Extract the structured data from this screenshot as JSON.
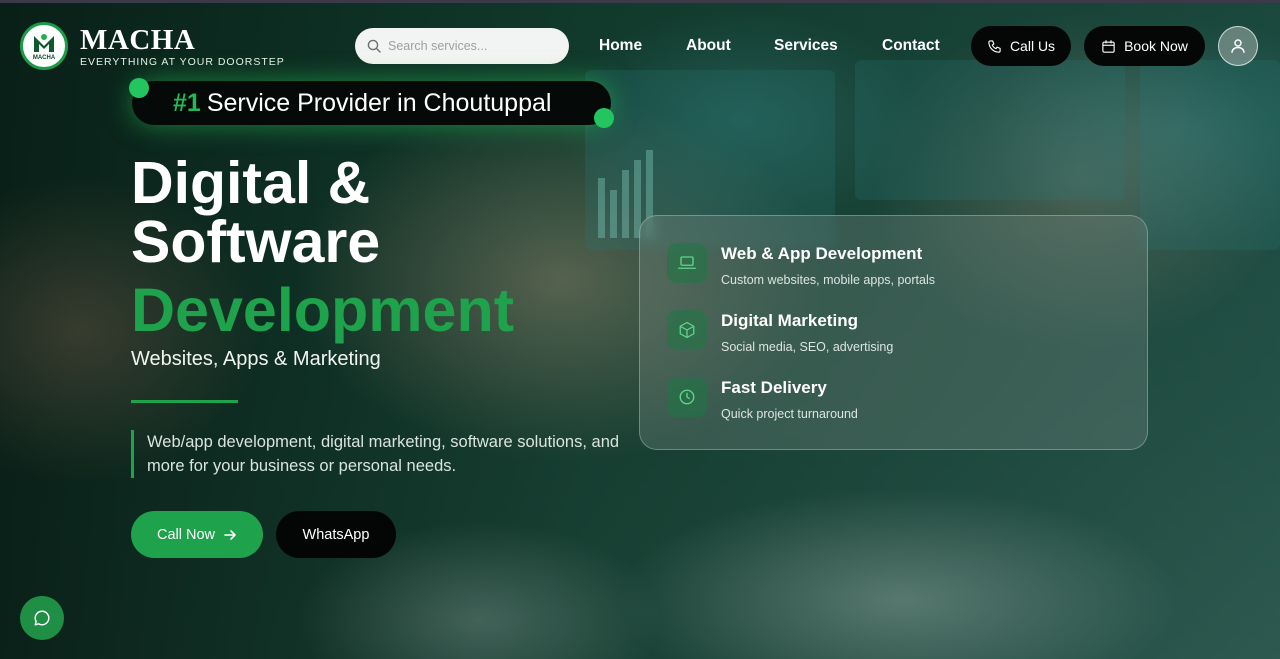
{
  "brand": {
    "name": "MACHA",
    "tagline": "EVERYTHING AT YOUR DOORSTEP",
    "logo_mark_text": "MACHA"
  },
  "search": {
    "placeholder": "Search services..."
  },
  "nav": {
    "home": "Home",
    "about": "About",
    "services": "Services",
    "contact": "Contact"
  },
  "header_actions": {
    "call_us": "Call Us",
    "book_now": "Book Now"
  },
  "badge": {
    "number": "#1",
    "text": "Service Provider in Choutuppal"
  },
  "hero": {
    "line1": "Digital &",
    "line2": "Software",
    "line3": "Development",
    "subheading": "Websites, Apps & Marketing",
    "description": "Web/app development, digital marketing, software solutions, and more for your business or personal needs.",
    "call_now": "Call Now",
    "whatsapp": "WhatsApp"
  },
  "features": [
    {
      "icon": "laptop-icon",
      "title": "Web & App Development",
      "subtitle": "Custom websites, mobile apps, portals"
    },
    {
      "icon": "cube-icon",
      "title": "Digital Marketing",
      "subtitle": "Social media, SEO, advertising"
    },
    {
      "icon": "clock-icon",
      "title": "Fast Delivery",
      "subtitle": "Quick project turnaround"
    }
  ],
  "colors": {
    "accent_green": "#1ea24c",
    "button_dark": "#050706"
  }
}
